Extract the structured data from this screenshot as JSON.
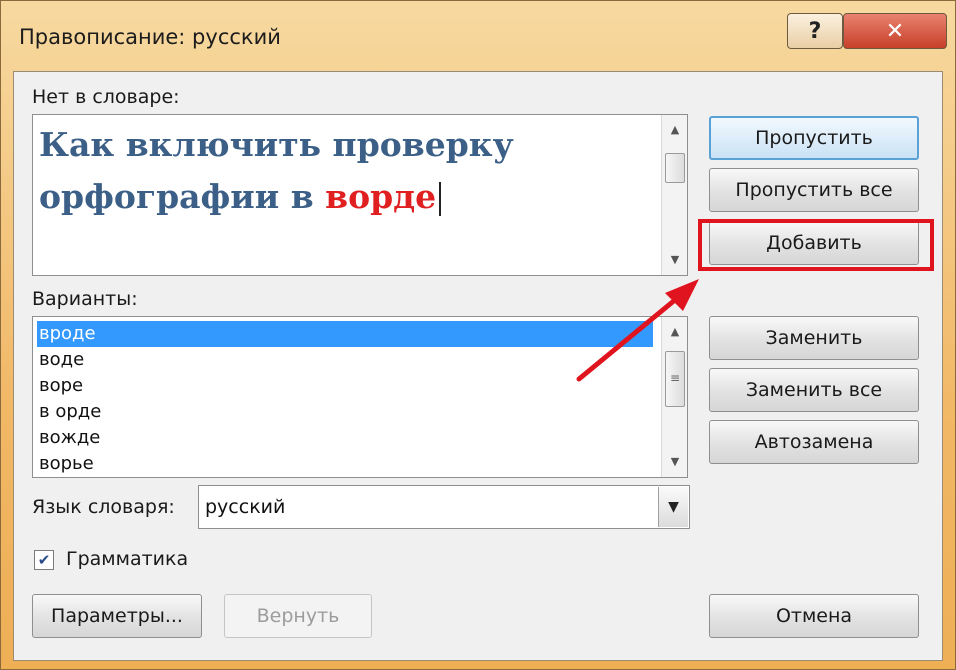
{
  "window": {
    "title": "Правописание: русский",
    "help_label": "?",
    "close_label": "✕"
  },
  "not_in_dict": {
    "label": "Нет в словаре:",
    "text_normal": "Как включить проверку орфографии в ",
    "text_error": "ворде"
  },
  "variants": {
    "label": "Варианты:",
    "items": [
      "вроде",
      "воде",
      "воре",
      "в орде",
      "вожде",
      "ворье"
    ],
    "selected_index": 0
  },
  "language": {
    "label": "Язык словаря:",
    "value": "русский"
  },
  "grammar": {
    "label": "Грамматика",
    "checked": true
  },
  "buttons": {
    "skip": "Пропустить",
    "skip_all": "Пропустить все",
    "add": "Добавить",
    "replace": "Заменить",
    "replace_all": "Заменить все",
    "autocorrect": "Автозамена",
    "options": "Параметры...",
    "undo": "Вернуть",
    "cancel": "Отмена"
  },
  "colors": {
    "annotation_red": "#e0141e",
    "selection_blue": "#3399ff",
    "text_blue": "#3b5f86"
  }
}
